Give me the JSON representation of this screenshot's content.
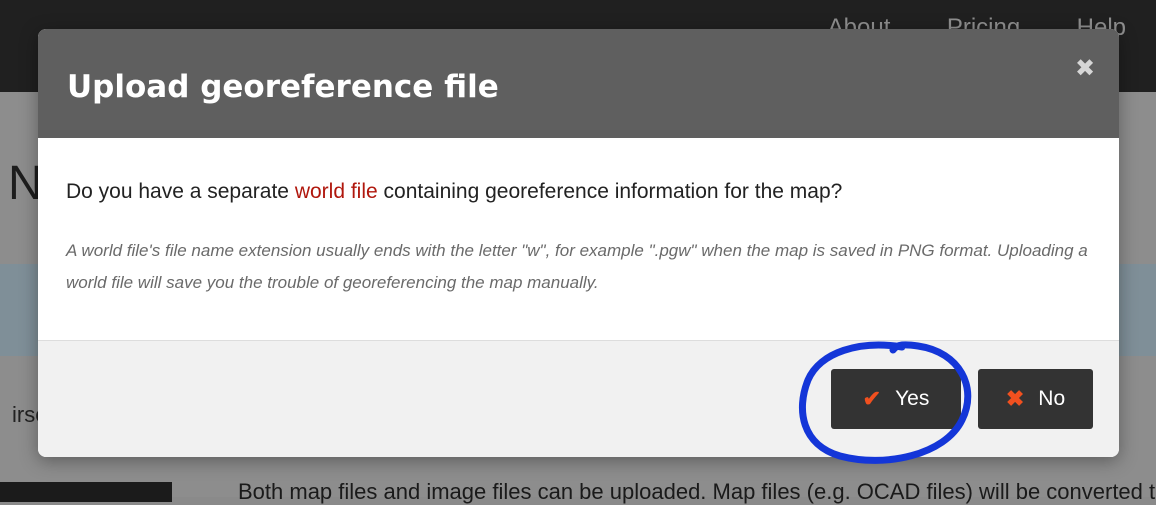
{
  "background": {
    "nav_items": [
      "About",
      "Pricing",
      "Help"
    ],
    "heading_fragment": "N",
    "side_fragment": "irse",
    "bottom_text": "Both map files and image files can be uploaded. Map files (e.g. OCAD files) will be converted to"
  },
  "modal": {
    "title": "Upload georeference file",
    "close_glyph": "✖",
    "question_before": "Do you have a separate ",
    "question_link": "world file",
    "question_after": " containing georeference information for the map?",
    "note": "A world file's file name extension usually ends with the letter \"w\", for example \".pgw\" when the map is saved in PNG format. Uploading a world file will save you the trouble of georeferencing the map manually.",
    "buttons": {
      "yes_label": "Yes",
      "yes_icon": "✔",
      "no_label": "No",
      "no_icon": "✖"
    }
  },
  "colors": {
    "header": "#5f5f5f",
    "link": "#b0170d",
    "button_bg": "#333333",
    "button_icon": "#f1501f",
    "annotation": "#1436d8"
  },
  "icons": {
    "close": "close-icon",
    "yes": "check-icon",
    "no": "x-icon"
  }
}
